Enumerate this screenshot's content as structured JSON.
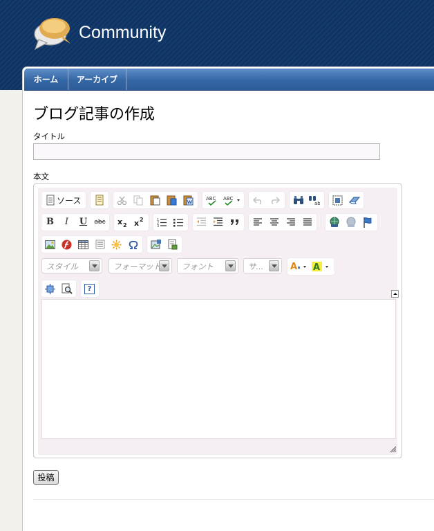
{
  "site": {
    "title": "Community"
  },
  "nav": {
    "tabs": [
      {
        "label": "ホーム"
      },
      {
        "label": "アーカイブ"
      }
    ]
  },
  "page": {
    "title": "ブログ記事の作成"
  },
  "form": {
    "title_label": "タイトル",
    "title_value": "",
    "body_label": "本文",
    "submit_label": "投稿"
  },
  "editor": {
    "source_label": "ソース",
    "style_placeholder": "スタイル",
    "format_placeholder": "フォーマット",
    "font_placeholder": "フォント",
    "size_placeholder": "サ...",
    "strike_glyph": "abc",
    "help_glyph": "?",
    "content": ""
  },
  "colors": {
    "header_bg": "#0e3466",
    "nav_bg": "#3567a6",
    "editor_bg": "#f5eff4"
  }
}
